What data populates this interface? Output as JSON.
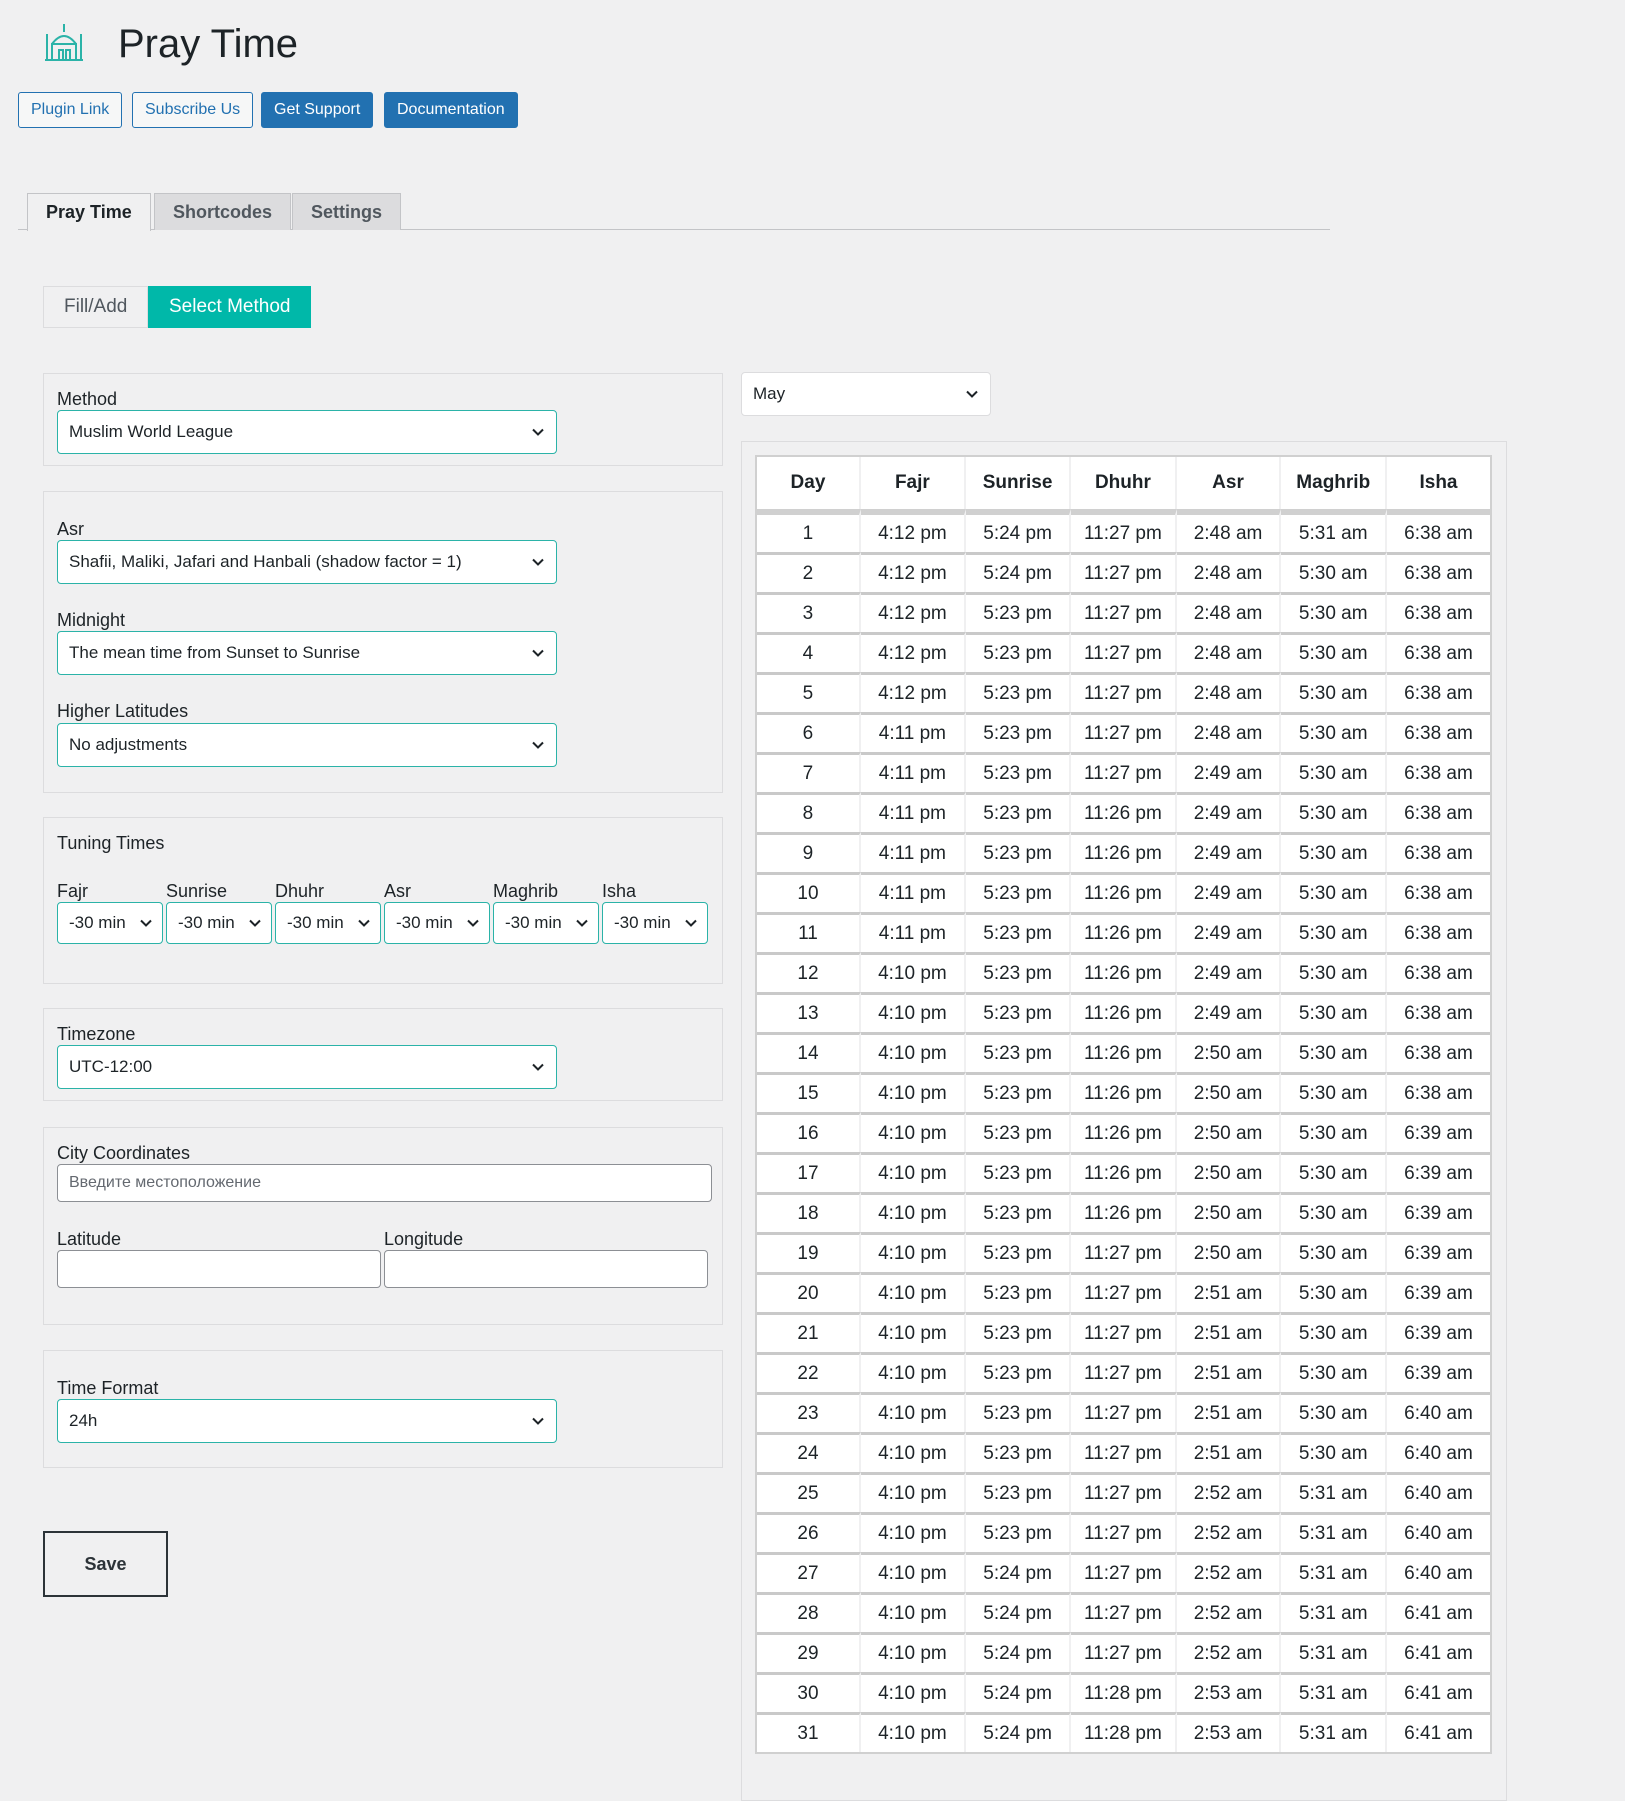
{
  "header": {
    "title": "Pray Time",
    "buttons": {
      "plugin_link": "Plugin Link",
      "subscribe": "Subscribe Us",
      "support": "Get Support",
      "docs": "Documentation"
    }
  },
  "tabs": {
    "pray_time": "Pray Time",
    "shortcodes": "Shortcodes",
    "settings": "Settings"
  },
  "subtabs": {
    "fill_add": "Fill/Add",
    "select_method": "Select Method"
  },
  "form": {
    "method": {
      "label": "Method",
      "value": "Muslim World League"
    },
    "asr": {
      "label": "Asr",
      "value": "Shafii, Maliki, Jafari and Hanbali (shadow factor = 1)"
    },
    "midnight": {
      "label": "Midnight",
      "value": "The mean time from Sunset to Sunrise"
    },
    "higher_latitudes": {
      "label": "Higher Latitudes",
      "value": "No adjustments"
    },
    "tuning": {
      "label": "Tuning Times",
      "items": [
        {
          "label": "Fajr",
          "value": "-30 min"
        },
        {
          "label": "Sunrise",
          "value": "-30 min"
        },
        {
          "label": "Dhuhr",
          "value": "-30 min"
        },
        {
          "label": "Asr",
          "value": "-30 min"
        },
        {
          "label": "Maghrib",
          "value": "-30 min"
        },
        {
          "label": "Isha",
          "value": "-30 min"
        }
      ]
    },
    "timezone": {
      "label": "Timezone",
      "value": "UTC-12:00"
    },
    "city": {
      "label": "City Coordinates",
      "placeholder": "Введите местоположение"
    },
    "latitude": {
      "label": "Latitude",
      "value": ""
    },
    "longitude": {
      "label": "Longitude",
      "value": ""
    },
    "time_format": {
      "label": "Time Format",
      "value": "24h"
    },
    "save_label": "Save"
  },
  "month": "May",
  "timetable": {
    "headers": [
      "Day",
      "Fajr",
      "Sunrise",
      "Dhuhr",
      "Asr",
      "Maghrib",
      "Isha"
    ],
    "rows": [
      [
        "1",
        "4:12 pm",
        "5:24 pm",
        "11:27 pm",
        "2:48 am",
        "5:31 am",
        "6:38 am"
      ],
      [
        "2",
        "4:12 pm",
        "5:24 pm",
        "11:27 pm",
        "2:48 am",
        "5:30 am",
        "6:38 am"
      ],
      [
        "3",
        "4:12 pm",
        "5:23 pm",
        "11:27 pm",
        "2:48 am",
        "5:30 am",
        "6:38 am"
      ],
      [
        "4",
        "4:12 pm",
        "5:23 pm",
        "11:27 pm",
        "2:48 am",
        "5:30 am",
        "6:38 am"
      ],
      [
        "5",
        "4:12 pm",
        "5:23 pm",
        "11:27 pm",
        "2:48 am",
        "5:30 am",
        "6:38 am"
      ],
      [
        "6",
        "4:11 pm",
        "5:23 pm",
        "11:27 pm",
        "2:48 am",
        "5:30 am",
        "6:38 am"
      ],
      [
        "7",
        "4:11 pm",
        "5:23 pm",
        "11:27 pm",
        "2:49 am",
        "5:30 am",
        "6:38 am"
      ],
      [
        "8",
        "4:11 pm",
        "5:23 pm",
        "11:26 pm",
        "2:49 am",
        "5:30 am",
        "6:38 am"
      ],
      [
        "9",
        "4:11 pm",
        "5:23 pm",
        "11:26 pm",
        "2:49 am",
        "5:30 am",
        "6:38 am"
      ],
      [
        "10",
        "4:11 pm",
        "5:23 pm",
        "11:26 pm",
        "2:49 am",
        "5:30 am",
        "6:38 am"
      ],
      [
        "11",
        "4:11 pm",
        "5:23 pm",
        "11:26 pm",
        "2:49 am",
        "5:30 am",
        "6:38 am"
      ],
      [
        "12",
        "4:10 pm",
        "5:23 pm",
        "11:26 pm",
        "2:49 am",
        "5:30 am",
        "6:38 am"
      ],
      [
        "13",
        "4:10 pm",
        "5:23 pm",
        "11:26 pm",
        "2:49 am",
        "5:30 am",
        "6:38 am"
      ],
      [
        "14",
        "4:10 pm",
        "5:23 pm",
        "11:26 pm",
        "2:50 am",
        "5:30 am",
        "6:38 am"
      ],
      [
        "15",
        "4:10 pm",
        "5:23 pm",
        "11:26 pm",
        "2:50 am",
        "5:30 am",
        "6:38 am"
      ],
      [
        "16",
        "4:10 pm",
        "5:23 pm",
        "11:26 pm",
        "2:50 am",
        "5:30 am",
        "6:39 am"
      ],
      [
        "17",
        "4:10 pm",
        "5:23 pm",
        "11:26 pm",
        "2:50 am",
        "5:30 am",
        "6:39 am"
      ],
      [
        "18",
        "4:10 pm",
        "5:23 pm",
        "11:26 pm",
        "2:50 am",
        "5:30 am",
        "6:39 am"
      ],
      [
        "19",
        "4:10 pm",
        "5:23 pm",
        "11:27 pm",
        "2:50 am",
        "5:30 am",
        "6:39 am"
      ],
      [
        "20",
        "4:10 pm",
        "5:23 pm",
        "11:27 pm",
        "2:51 am",
        "5:30 am",
        "6:39 am"
      ],
      [
        "21",
        "4:10 pm",
        "5:23 pm",
        "11:27 pm",
        "2:51 am",
        "5:30 am",
        "6:39 am"
      ],
      [
        "22",
        "4:10 pm",
        "5:23 pm",
        "11:27 pm",
        "2:51 am",
        "5:30 am",
        "6:39 am"
      ],
      [
        "23",
        "4:10 pm",
        "5:23 pm",
        "11:27 pm",
        "2:51 am",
        "5:30 am",
        "6:40 am"
      ],
      [
        "24",
        "4:10 pm",
        "5:23 pm",
        "11:27 pm",
        "2:51 am",
        "5:30 am",
        "6:40 am"
      ],
      [
        "25",
        "4:10 pm",
        "5:23 pm",
        "11:27 pm",
        "2:52 am",
        "5:31 am",
        "6:40 am"
      ],
      [
        "26",
        "4:10 pm",
        "5:23 pm",
        "11:27 pm",
        "2:52 am",
        "5:31 am",
        "6:40 am"
      ],
      [
        "27",
        "4:10 pm",
        "5:24 pm",
        "11:27 pm",
        "2:52 am",
        "5:31 am",
        "6:40 am"
      ],
      [
        "28",
        "4:10 pm",
        "5:24 pm",
        "11:27 pm",
        "2:52 am",
        "5:31 am",
        "6:41 am"
      ],
      [
        "29",
        "4:10 pm",
        "5:24 pm",
        "11:27 pm",
        "2:52 am",
        "5:31 am",
        "6:41 am"
      ],
      [
        "30",
        "4:10 pm",
        "5:24 pm",
        "11:28 pm",
        "2:53 am",
        "5:31 am",
        "6:41 am"
      ],
      [
        "31",
        "4:10 pm",
        "5:24 pm",
        "11:28 pm",
        "2:53 am",
        "5:31 am",
        "6:41 am"
      ]
    ]
  },
  "colors": {
    "wp_blue": "#2271b1",
    "teal": "#00b8a9",
    "background": "#f0f0f1"
  },
  "icons": {
    "logo": "mosque-icon",
    "dropdown": "chevron-down-icon"
  }
}
